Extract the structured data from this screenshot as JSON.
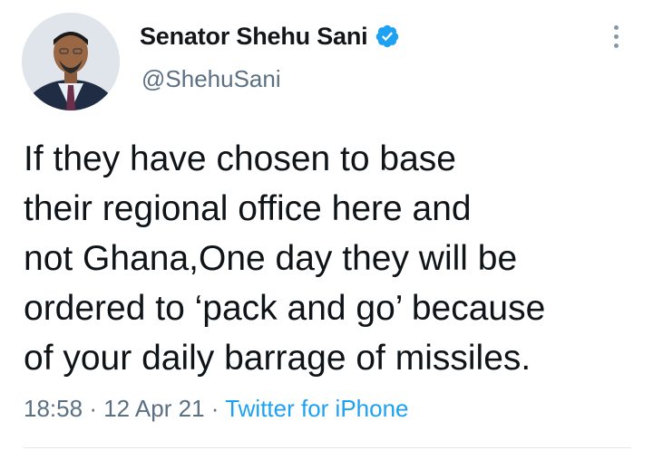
{
  "author": {
    "display_name": "Senator Shehu Sani",
    "handle": "@ShehuSani",
    "verified_icon": "verified-badge-icon",
    "avatar": "profile-photo"
  },
  "menu": {
    "icon": "more-vertical-icon"
  },
  "tweet": {
    "lines": [
      "If they have chosen to base",
      "their regional office here and",
      "not Ghana,One day they will be",
      "ordered to ‘pack and go’ because",
      "of your daily barrage of missiles."
    ],
    "time": "18:58",
    "separator": "·",
    "date": "12 Apr 21",
    "source": "Twitter for iPhone"
  },
  "colors": {
    "link_blue": "#1da1f2",
    "secondary_text": "#5b7083",
    "primary_text": "#0f1419"
  }
}
